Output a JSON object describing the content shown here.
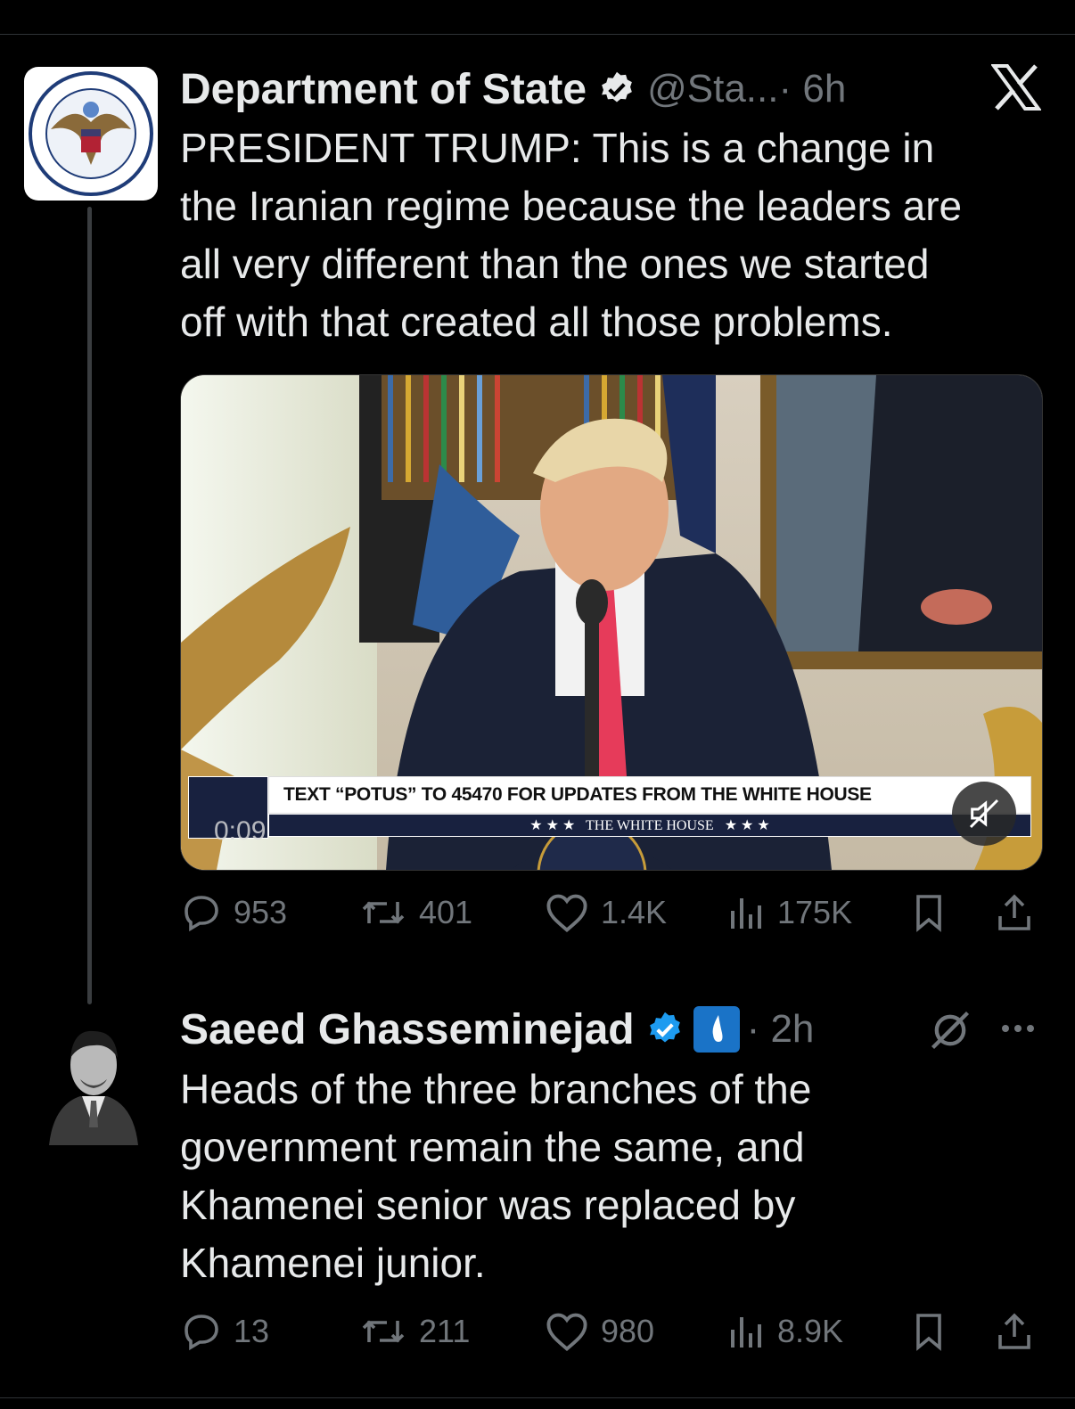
{
  "tweet1": {
    "author": {
      "name": "Department of State",
      "handle": "@Sta...",
      "verified": true,
      "avatar_icon": "us-department-of-state-seal"
    },
    "time": "· 6h",
    "text_lines": [
      "PRESIDENT TRUMP: This is a change in",
      "the Iranian regime because the leaders are",
      "all very different than the ones we started",
      "off with that created all those problems."
    ],
    "media": {
      "type": "video",
      "lower_third": "TEXT “POTUS” TO 45470 FOR UPDATES FROM THE WHITE HOUSE",
      "lower_third_sub": "★ ★ ★   THE WHITE HOUSE   ★ ★ ★",
      "timecode": "0:09",
      "muted": true
    },
    "stats": {
      "replies": "953",
      "reposts": "401",
      "likes": "1.4K",
      "views": "175K"
    }
  },
  "tweet2": {
    "author": {
      "name": "Saeed Ghasseminejad",
      "verified": true,
      "affiliate_badge_icon": "affiliate-badge-icon",
      "avatar_icon": "user-portrait"
    },
    "time": "· 2h",
    "text_lines": [
      "Heads of the three branches of the",
      "government remain the same, and",
      "Khamenei senior was replaced by",
      "Khamenei junior."
    ],
    "stats": {
      "replies": "13",
      "reposts": "211",
      "likes": "980",
      "views": "8.9K"
    }
  },
  "colors": {
    "background": "#000000",
    "text": "#e7e9ea",
    "secondary": "#71767b",
    "verified": "#1d9bf0",
    "accent_badge": "#1a73c7"
  }
}
